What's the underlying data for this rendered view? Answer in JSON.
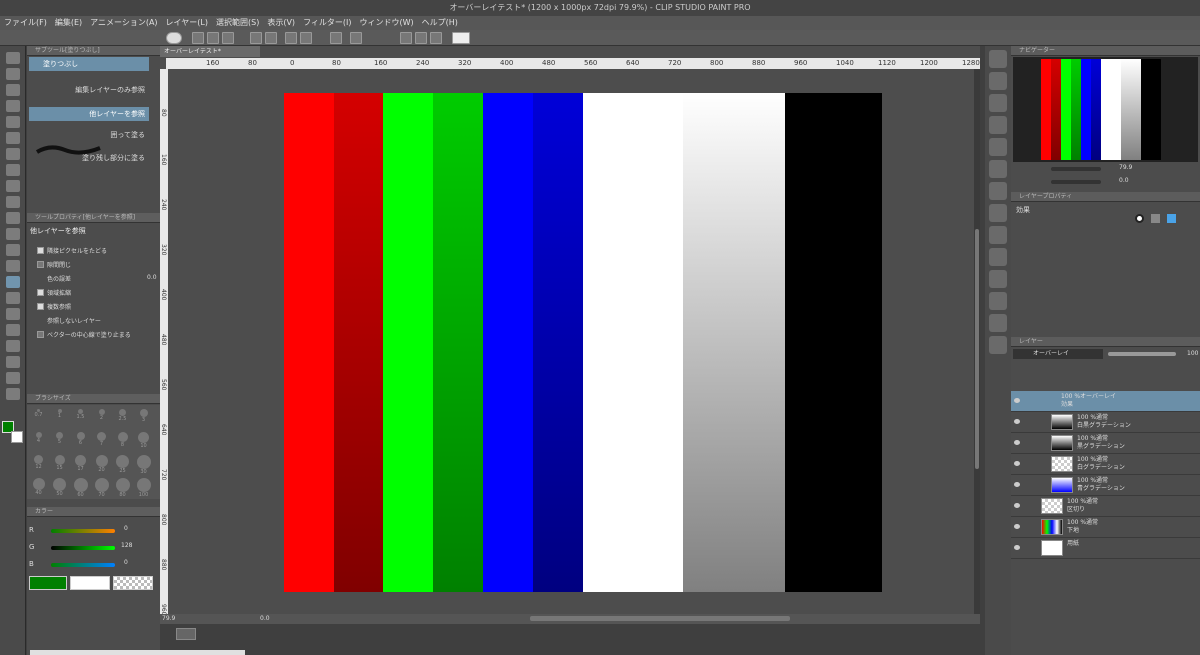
{
  "window": {
    "title": "オーバーレイテスト* (1200 x 1000px 72dpi 79.9%) - CLIP STUDIO PAINT PRO"
  },
  "menu": [
    "ファイル(F)",
    "編集(E)",
    "アニメーション(A)",
    "レイヤー(L)",
    "選択範囲(S)",
    "表示(V)",
    "フィルター(I)",
    "ウィンドウ(W)",
    "ヘルプ(H)"
  ],
  "subtool_panel": {
    "tab_label": "サブツール[塗りつぶし]",
    "group_label": "塗りつぶし",
    "items": [
      "編集レイヤーのみ参照",
      "他レイヤーを参照",
      "囲って塗る",
      "塗り残し部分に塗る"
    ]
  },
  "tool_property": {
    "tab_label": "ツールプロパティ[他レイヤーを参照]",
    "title": "他レイヤーを参照",
    "rows": [
      {
        "label": "隣接ピクセルをたどる",
        "checked": true
      },
      {
        "label": "隙間閉じ",
        "checked": false
      },
      {
        "label": "色の誤差",
        "value": "0.0"
      },
      {
        "label": "領域拡縮",
        "checked": true
      },
      {
        "label": "複数参照",
        "checked": true
      },
      {
        "label": "参照しないレイヤー"
      },
      {
        "label": "ベクターの中心線で塗り止まる",
        "checked": false
      }
    ]
  },
  "brush_size": {
    "tab_label": "ブラシサイズ",
    "sizes": [
      "0.7",
      "1",
      "1.5",
      "2",
      "2.5",
      "3",
      "4",
      "5",
      "6",
      "7",
      "8",
      "10",
      "12",
      "15",
      "17",
      "20",
      "25",
      "30",
      "40",
      "50",
      "60",
      "70",
      "80",
      "100"
    ]
  },
  "color": {
    "tab_label": "カラー",
    "r": {
      "label": "R",
      "value": "0"
    },
    "g": {
      "label": "G",
      "value": "128"
    },
    "b": {
      "label": "B",
      "value": "0"
    },
    "main": "#008000",
    "sub": "#ffffff"
  },
  "canvas": {
    "tab_label": "オーバーレイテスト*",
    "ruler_h": [
      "160",
      "80",
      "0",
      "80",
      "160",
      "240",
      "320",
      "400",
      "480",
      "560",
      "640",
      "720",
      "800",
      "880",
      "960",
      "1040",
      "1120",
      "1200",
      "1280",
      "136"
    ],
    "ruler_v": [
      "80",
      "160",
      "240",
      "320",
      "400",
      "480",
      "560",
      "640",
      "720",
      "800",
      "880",
      "960"
    ],
    "stripes": [
      {
        "color": "#ff0000"
      },
      {
        "color": "#c80000",
        "gradient": "linear-gradient(#d40000,#800000)"
      },
      {
        "color": "#00ff00"
      },
      {
        "color": "#00aa00",
        "gradient": "linear-gradient(#00cc00,#008000)"
      },
      {
        "color": "#0000ff"
      },
      {
        "color": "#0000b0",
        "gradient": "linear-gradient(#0000d8,#000080)"
      },
      {
        "color": "#ffffff"
      },
      {
        "color": "#dddddd",
        "gradient": "linear-gradient(#ffffff,#808080)"
      },
      {
        "color": "#000000"
      }
    ],
    "zoom": "79.9"
  },
  "navigator": {
    "tab_label": "ナビゲーター",
    "zoom": "79.9",
    "rotate": "0.0"
  },
  "layer_property": {
    "tab_label": "レイヤープロパティ",
    "effect_label": "効果"
  },
  "layers_panel": {
    "tab_label": "レイヤー",
    "blend_mode": "オーバーレイ",
    "opacity": "100",
    "layers": [
      {
        "line1": "100 %オーバーレイ",
        "line2": "効果",
        "folder": true
      },
      {
        "line1": "100 %通常",
        "line2": "白黒グラデーション"
      },
      {
        "line1": "100 %通常",
        "line2": "黒グラデーション"
      },
      {
        "line1": "100 %通常",
        "line2": "白グラデーション"
      },
      {
        "line1": "100 %通常",
        "line2": "青グラデーション"
      },
      {
        "line1": "100 %通常",
        "line2": "区切り"
      },
      {
        "line1": "100 %通常",
        "line2": "下地"
      },
      {
        "line1": "",
        "line2": "用紙"
      }
    ]
  },
  "status": {
    "zoom": "79.9",
    "angle": "0.0"
  }
}
